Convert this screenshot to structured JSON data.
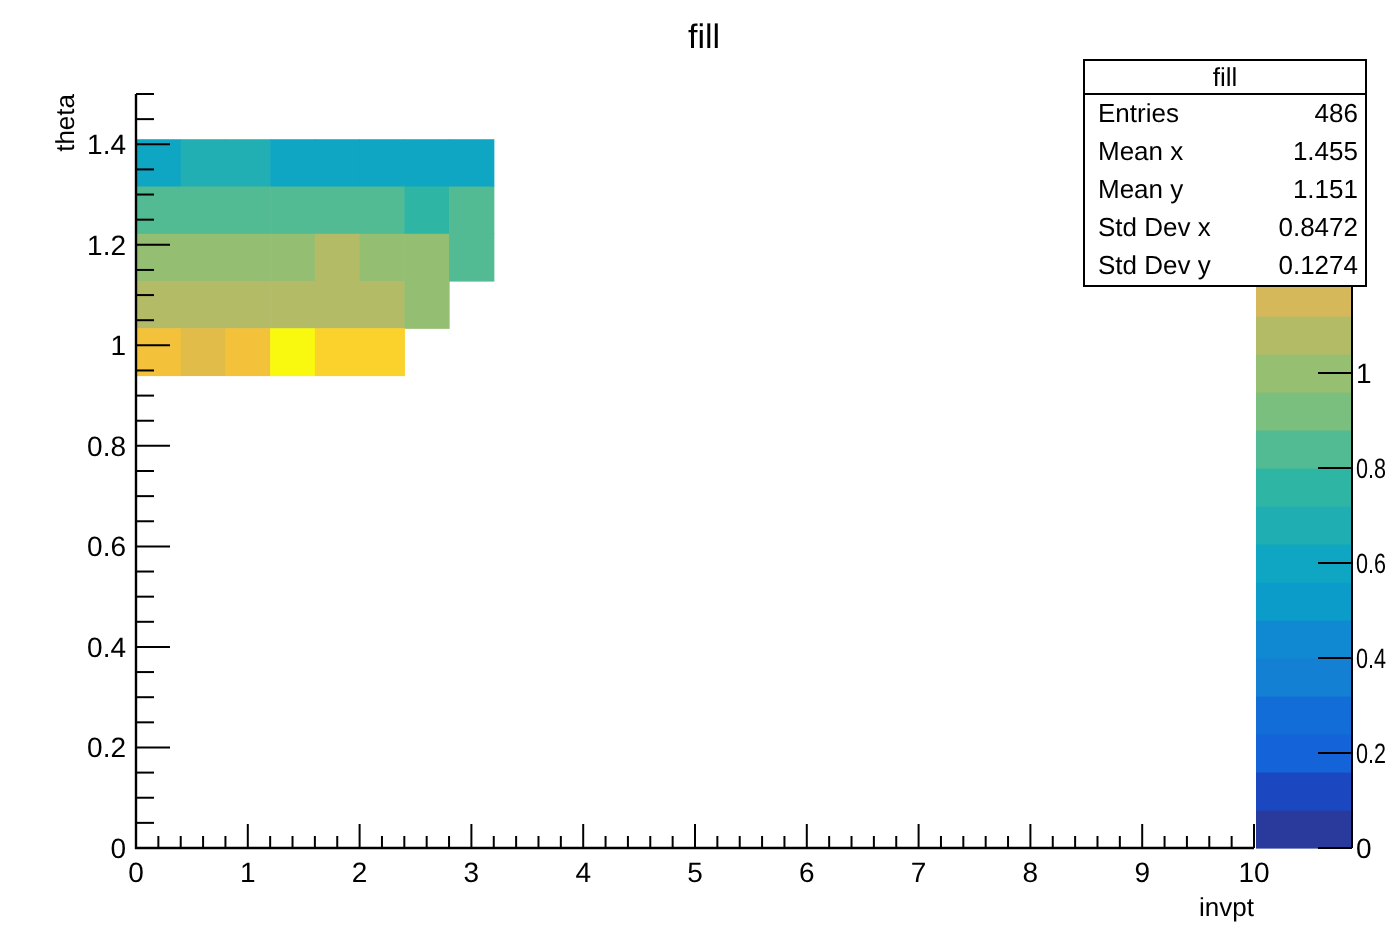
{
  "title": "fill",
  "plot": {
    "x_axis": {
      "title": "invpt",
      "ticks": [
        "0",
        "1",
        "2",
        "3",
        "4",
        "5",
        "6",
        "7",
        "8",
        "9",
        "10"
      ]
    },
    "y_axis": {
      "title": "theta",
      "ticks": [
        "1.4",
        "1.2",
        "1",
        "0.8",
        "0.6",
        "0.4",
        "0.2",
        "0"
      ]
    },
    "cells": [
      {
        "bins": [
          {
            "color": "#0ea6c2"
          },
          {
            "color": "#21afb3"
          },
          {
            "color": "#21afb3"
          },
          {
            "color": "#0ea6c2"
          },
          {
            "color": "#0ea6c2"
          },
          {
            "color": "#0ea6c2"
          },
          {
            "color": "#0ea6c2"
          },
          {
            "color": "#0ea6c2"
          }
        ]
      },
      {
        "bins": [
          {
            "color": "#52bb93"
          },
          {
            "color": "#52bb93"
          },
          {
            "color": "#52bb93"
          },
          {
            "color": "#52bb93"
          },
          {
            "color": "#52bb93"
          },
          {
            "color": "#52bb93"
          },
          {
            "color": "#2fb5a4"
          },
          {
            "color": "#52bb93"
          }
        ]
      },
      {
        "bins": [
          {
            "color": "#94bf72"
          },
          {
            "color": "#94bf72"
          },
          {
            "color": "#94bf72"
          },
          {
            "color": "#94bf72"
          },
          {
            "color": "#b3bb66"
          },
          {
            "color": "#94bf72"
          },
          {
            "color": "#94bf72"
          },
          {
            "color": "#52bb93"
          }
        ]
      },
      {
        "bins": [
          {
            "color": "#b3bb66"
          },
          {
            "color": "#b3bb66"
          },
          {
            "color": "#b3bb66"
          },
          {
            "color": "#b3bb66"
          },
          {
            "color": "#b3bb66"
          },
          {
            "color": "#b3bb66"
          },
          {
            "color": "#94bf72"
          }
        ]
      },
      {
        "bins": [
          {
            "color": "#f4c23a"
          },
          {
            "color": "#e2bc48"
          },
          {
            "color": "#f4c23a"
          },
          {
            "color": "#f8f90e"
          },
          {
            "color": "#fbd22c"
          },
          {
            "color": "#fbd22c"
          }
        ]
      }
    ]
  },
  "color_scale": {
    "bands": [
      {
        "color": "#2a3a9c"
      },
      {
        "color": "#1b48c0"
      },
      {
        "color": "#1563d8"
      },
      {
        "color": "#136dd8"
      },
      {
        "color": "#1380d4"
      },
      {
        "color": "#1188d2"
      },
      {
        "color": "#0b9cca"
      },
      {
        "color": "#0ea6c2"
      },
      {
        "color": "#1fafb2"
      },
      {
        "color": "#2fb5a4"
      },
      {
        "color": "#52bb93"
      },
      {
        "color": "#7bbf7e"
      },
      {
        "color": "#96bf72"
      },
      {
        "color": "#b3bb66"
      },
      {
        "color": "#d4b85a"
      }
    ],
    "ticks": [
      "1",
      "0.8",
      "0.6",
      "0.4",
      "0.2",
      "0"
    ]
  },
  "stats": {
    "title": "fill",
    "rows": [
      {
        "label": "Entries",
        "value": "486"
      },
      {
        "label": "Mean x",
        "value": "1.455"
      },
      {
        "label": "Mean y",
        "value": "1.151"
      },
      {
        "label": "Std Dev x",
        "value": "0.8472"
      },
      {
        "label": "Std Dev y",
        "value": "0.1274"
      }
    ]
  }
}
